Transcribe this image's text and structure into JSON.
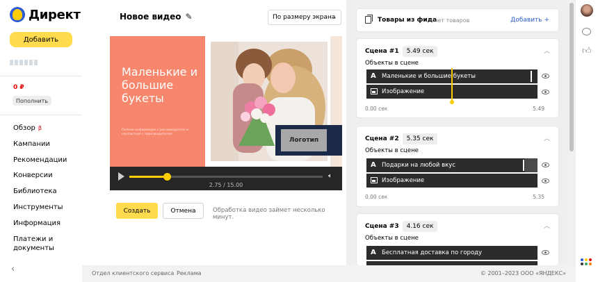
{
  "brand": {
    "name": "Директ",
    "colors": {
      "yellow": "#ffdb4d",
      "blue": "#2b5bd7",
      "red": "#e00000"
    }
  },
  "sidebar": {
    "add_label": "Добавить",
    "balance": "0 ₽",
    "topup_label": "Пополнить",
    "items": [
      {
        "label": "Обзор",
        "badge": "β"
      },
      {
        "label": "Кампании"
      },
      {
        "label": "Рекомендации"
      },
      {
        "label": "Конверсии"
      },
      {
        "label": "Библиотека"
      },
      {
        "label": "Инструменты"
      },
      {
        "label": "Информация"
      },
      {
        "label": "Платежи и документы"
      }
    ],
    "collapse_icon": "chevron-left-icon"
  },
  "editor": {
    "title": "Новое видео",
    "fit_option": "По размеру экрана",
    "video": {
      "heading": "Маленькие и большие букеты",
      "small_text": "Полная информация о рекламодателе и контактная с производителем",
      "logo_label": "Логотип",
      "time": "2.75 / 15.00",
      "progress": 0.195
    },
    "create_label": "Создать",
    "cancel_label": "Отмена",
    "processing_note": "Обработка видео займет несколько минут."
  },
  "feed": {
    "title": "Товары из фида",
    "subtitle": "нет товаров",
    "add_label": "Добавить +"
  },
  "scenes": [
    {
      "name": "Сцена #1",
      "duration": "5.49 сек",
      "objects_label": "Объекты в сцене",
      "objects": [
        {
          "type": "text",
          "label": "Маленькие и большие букеты"
        },
        {
          "type": "image",
          "label": "Изображение"
        }
      ],
      "start": "0.00 сек",
      "end": "5.49",
      "playhead": 0.5
    },
    {
      "name": "Сцена #2",
      "duration": "5.35 сек",
      "objects_label": "Объекты в сцене",
      "objects": [
        {
          "type": "text",
          "label": "Подарки на любой вкус"
        },
        {
          "type": "image",
          "label": "Изображение"
        }
      ],
      "start": "0.00 сек",
      "end": "5.35"
    },
    {
      "name": "Сцена #3",
      "duration": "4.16 сек",
      "objects_label": "Объекты в сцене",
      "objects": [
        {
          "type": "text",
          "label": "Бесплатная доставка по городу"
        }
      ]
    }
  ],
  "footer": {
    "support": "Отдел клиентского сервиса",
    "ads": "Реклама",
    "copyright": "© 2001–2023 ООО «ЯНДЕКС»"
  }
}
